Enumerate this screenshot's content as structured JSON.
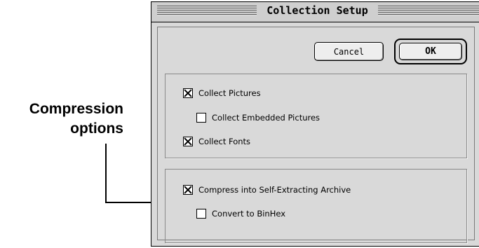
{
  "annotation": {
    "line1": "Compression",
    "line2": "options"
  },
  "dialog": {
    "title": "Collection Setup",
    "buttons": {
      "cancel": "Cancel",
      "ok": "OK"
    },
    "collect_group": {
      "items": [
        {
          "label": "Collect Pictures",
          "checked": true
        },
        {
          "label": "Collect Embedded Pictures",
          "checked": false
        },
        {
          "label": "Collect Fonts",
          "checked": true
        }
      ]
    },
    "compression_group": {
      "items": [
        {
          "label": "Compress into Self-Extracting Archive",
          "checked": true
        },
        {
          "label": "Convert to BinHex",
          "checked": false
        }
      ]
    }
  }
}
